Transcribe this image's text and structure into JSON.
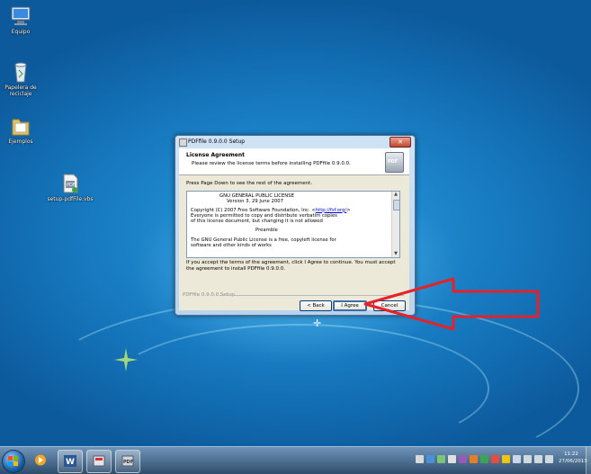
{
  "desktop": {
    "icons": [
      {
        "label": "Equipo"
      },
      {
        "label": "Papelera de reciclaje"
      },
      {
        "label": "Ejemplos"
      },
      {
        "label": "setup-pdfFile.vbs"
      }
    ]
  },
  "installer": {
    "title": "PDFfile 0.9.0.0 Setup",
    "close_glyph": "✕",
    "header_title": "License Agreement",
    "header_subtitle": "Please review the license terms before installing PDFfile 0.9.0.0.",
    "logo_text": "PDF",
    "instruction": "Press Page Down to see the rest of the agreement.",
    "license_lines": [
      "GNU GENERAL PUBLIC LICENSE",
      "Version 3, 29 June 2007",
      "Copyright (C) 2007 Free Software Foundation, Inc. <",
      "http://fsf.org/",
      ">",
      "Everyone is permitted to copy and distribute verbatim copies",
      "of this license document, but changing it is not allowed",
      "Preamble",
      "The GNU General Public License is a free, copyleft license for",
      "software and other kinds of works"
    ],
    "agree_message": "If you accept the terms of the agreement, click I Agree to continue. You must accept the agreement to install PDFfile 0.9.0.0.",
    "branding": "PDFfile 0.9.0.0 Setup",
    "buttons": {
      "back": "< Back",
      "agree": "I Agree",
      "cancel": "Cancel"
    }
  },
  "taskbar": {
    "pinned": [
      {
        "icon": "media-player-icon"
      },
      {
        "icon": "word-icon"
      },
      {
        "icon": "pdf-tool-icon"
      },
      {
        "icon": "installer-icon"
      }
    ],
    "clock": {
      "time": "11:22",
      "date": "27/06/2013"
    }
  },
  "colors": {
    "arrow": "#e5222a",
    "desktop_blue": "#1677bd"
  }
}
